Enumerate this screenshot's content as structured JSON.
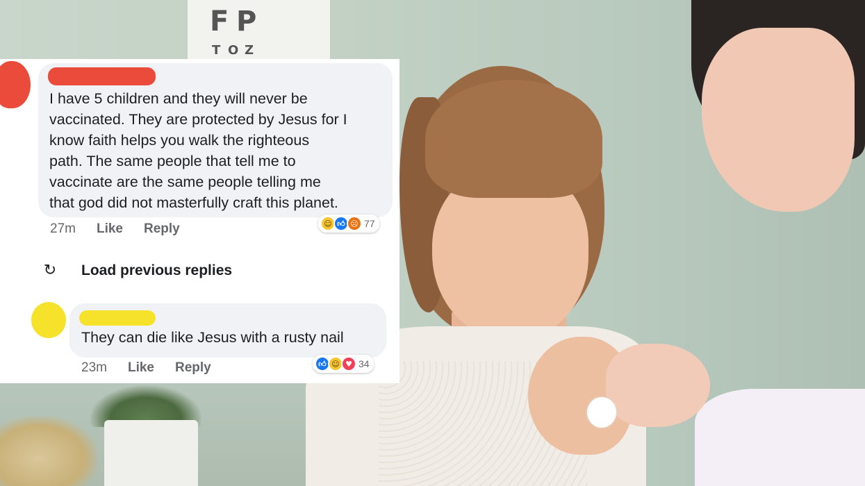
{
  "eye_chart": {
    "rows": [
      [
        "F",
        "P"
      ],
      [
        "T",
        "O",
        "Z"
      ]
    ]
  },
  "comments": [
    {
      "text": "I have 5 children and they will never be\nvaccinated. They are protected by Jesus for I\nknow faith helps you walk the righteous\npath. The same people that tell me to\nvaccinate are the same people telling me\nthat god did not masterfully craft this planet.",
      "time": "27m",
      "like_label": "Like",
      "reply_label": "Reply",
      "reactions": {
        "icons": [
          "haha-icon",
          "like-icon",
          "angry-icon"
        ],
        "count": "77"
      },
      "redaction_color": "#ea4b3b"
    },
    {
      "text": "They can die like Jesus with a rusty nail",
      "time": "23m",
      "like_label": "Like",
      "reply_label": "Reply",
      "reactions": {
        "icons": [
          "like-icon",
          "haha-icon",
          "love-icon"
        ],
        "count": "34"
      },
      "redaction_color": "#f6e22a"
    }
  ],
  "load_previous": {
    "label": "Load previous replies",
    "icon": "refresh-icon"
  },
  "colors": {
    "bubble": "#f0f2f5",
    "meta_text": "#65676b",
    "like_blue": "#1877f2",
    "love_red": "#f33e58"
  }
}
